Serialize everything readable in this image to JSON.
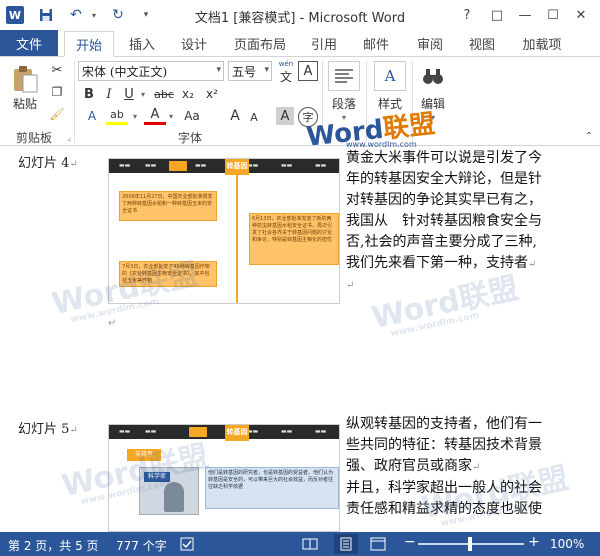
{
  "window": {
    "title": "文档1 [兼容模式] - Microsoft Word",
    "logo_letter": "W",
    "help": "?",
    "restore": "□",
    "minimize": "—",
    "maximize": "☐",
    "close": "✕"
  },
  "ribbon_tabs": {
    "file": "文件",
    "items": [
      "开始",
      "插入",
      "设计",
      "页面布局",
      "引用",
      "邮件",
      "审阅",
      "视图",
      "加载项"
    ],
    "active": "开始"
  },
  "ribbon": {
    "paste_label": "粘贴",
    "clipboard_label": "剪贴板",
    "font_name": "宋体 (中文正文)",
    "font_size": "五号",
    "wen_label": "wén",
    "wen_char": "文",
    "A_box": "A",
    "bold": "B",
    "italic": "I",
    "underline": "U",
    "strike": "abc",
    "subscript": "x₂",
    "superscript": "x²",
    "highlight": "ab",
    "font_color": "A",
    "aa": "Aa",
    "grow": "A",
    "shrink": "A",
    "char_shade": "A",
    "enclose": "字",
    "font_label": "字体",
    "paragraph_label": "段落",
    "styles_label": "样式",
    "editing_label": "编辑"
  },
  "document": {
    "slide4_label": "幻灯片 4",
    "slide5_label": "幻灯片 5",
    "para4": [
      "黄金大米事件可以说是引发了今",
      "年的转基因安全大辩论，但是针",
      "对转基因的争论其实早已有之，",
      "我国从　针对转基因粮食安全与",
      "否,社会的声音主要分成了三种,",
      "我们先来看下第一种，支持者"
    ],
    "para5": [
      "纵观转基因的支持者，他们有一",
      "些共同的特征：转基因技术背景",
      "强、政府官员或商家",
      "并且，科学家超出一般人的社会",
      "责任感和精益求精的态度也驱使"
    ],
    "slide4": {
      "header": "转基因",
      "callout1": "2009年11月27日，中国农业部批准颁发了两种转基因水稻和一种转基因玉米的安全证书",
      "callout2": "7月3日，农业部批复了49种转基因作物的《农业转基因生物安全证书》，其中包括玉米等作物",
      "callout3": "6月13日，农业部批准发放了新的两种抗虫转基因水稻安全证书，再次引发了社会各界关于转基因问题的讨论和争论，特别是转基因主粮化的担忧"
    },
    "slide5": {
      "header": "转基因",
      "tag": "支持者",
      "person_label": "科学家",
      "text": "他们是转基因的研究者，也是转基因的受益者。他们认为转基因是安全的，可以带来巨大的社会效益，而反对者往往缺乏科学依据"
    }
  },
  "watermark": {
    "brand_en": "Word",
    "brand_cn": "联盟",
    "url": "www.wordlm.com"
  },
  "status": {
    "page": "第 2 页，共 5 页",
    "words": "777 个字",
    "zoom": "100%",
    "minus": "−",
    "plus": "+"
  },
  "colors": {
    "accent": "#2b579a",
    "callout": "#ffc46a",
    "slide_bar": "#2a2a2a"
  }
}
